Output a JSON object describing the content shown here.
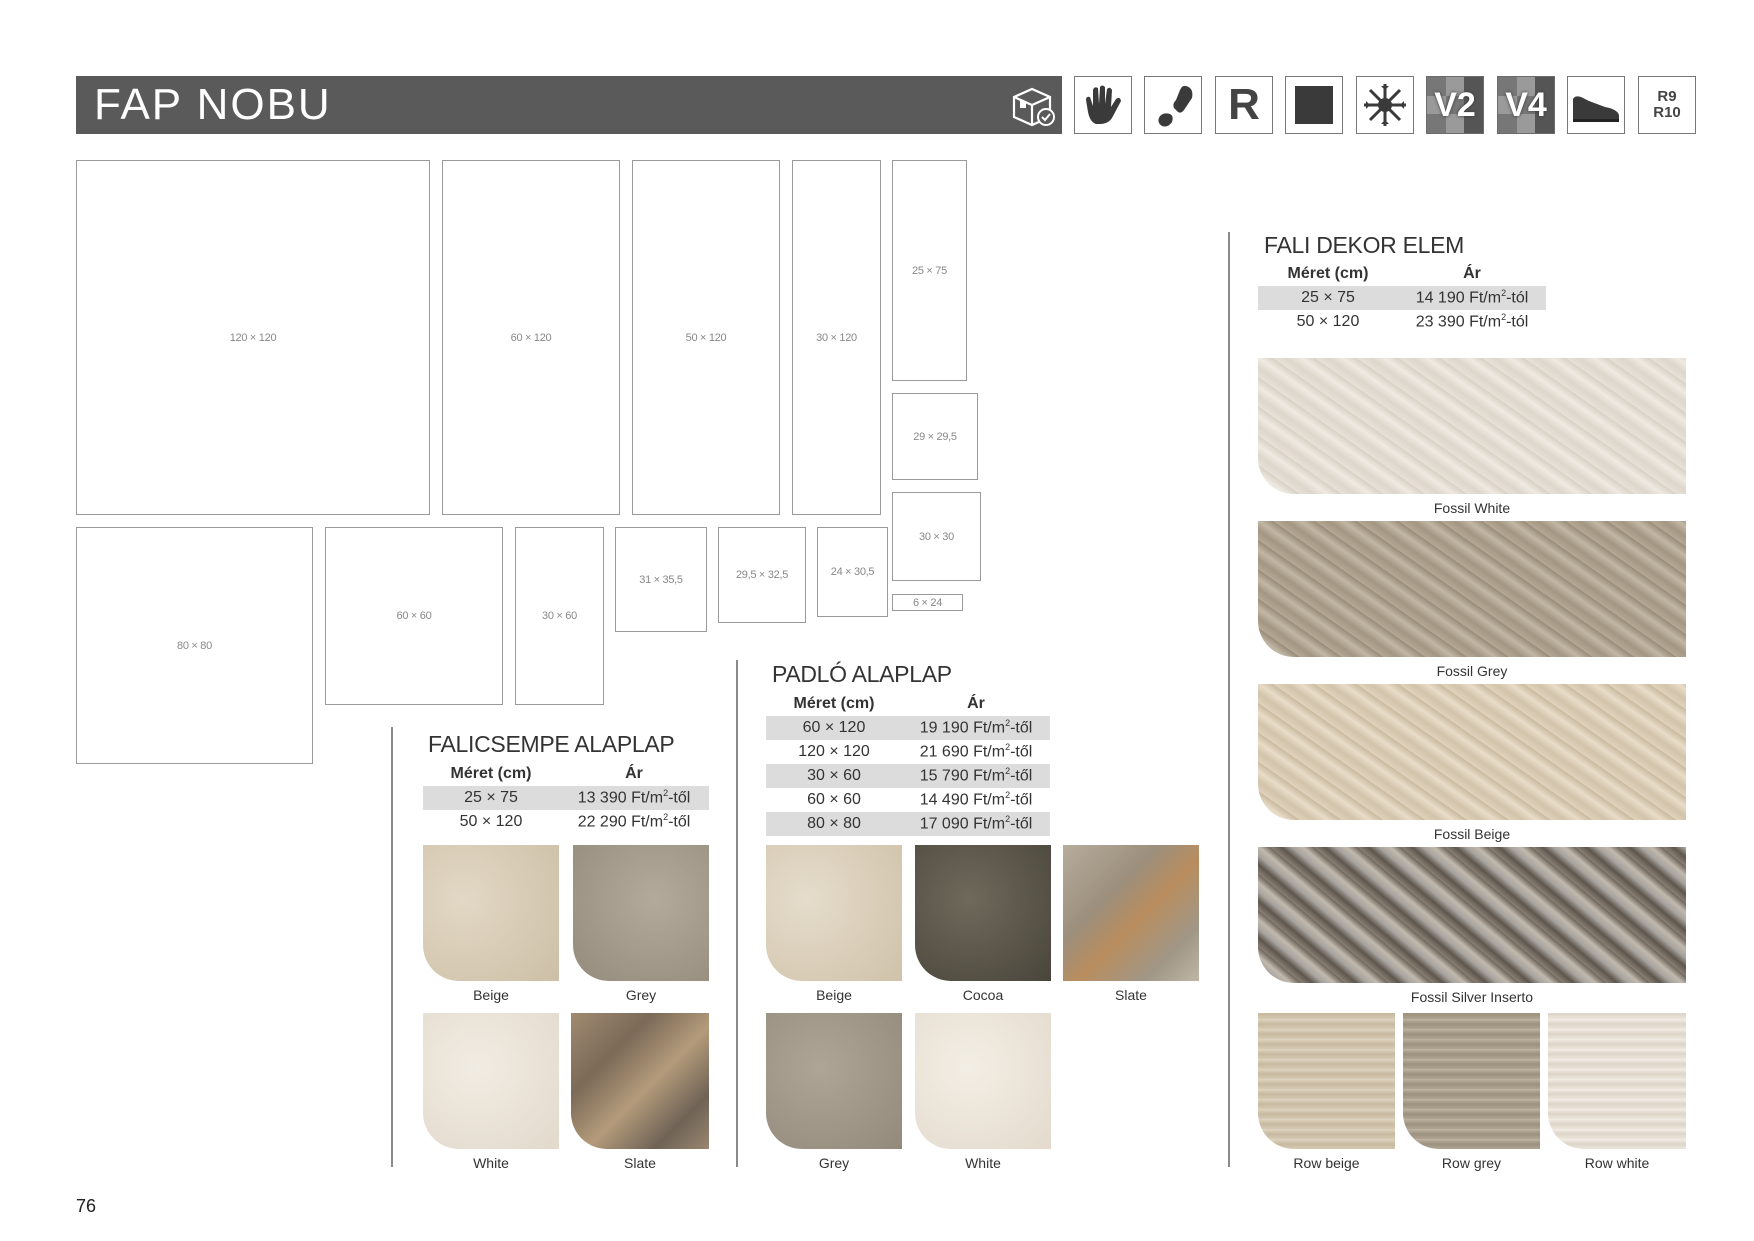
{
  "header": {
    "title": "FAP NOBU"
  },
  "icons": {
    "header_icon": "box-check-icon",
    "features": [
      "hand-icon",
      "foot-icon",
      "r-icon",
      "square-icon",
      "snowflake-icon",
      "v2-icon",
      "v4-icon",
      "shoe-icon",
      "rating-icon"
    ],
    "r_label": "R",
    "v2_label": "V2",
    "v4_label": "V4",
    "rating_line1": "R9",
    "rating_line2": "R10"
  },
  "sizes": {
    "s120x120": "120 × 120",
    "s60x120": "60 × 120",
    "s50x120": "50 × 120",
    "s30x120": "30 × 120",
    "s25x75": "25 × 75",
    "s29x295": "29 × 29,5",
    "s30x30": "30 × 30",
    "s6x24": "6 × 24",
    "s80x80": "80 × 80",
    "s60x60": "60 × 60",
    "s30x60": "30 × 60",
    "s31x355": "31 × 35,5",
    "s295x325": "29,5 × 32,5",
    "s24x305": "24 × 30,5"
  },
  "falicsempe": {
    "title": "FALICSEMPE ALAPLAP",
    "col_size": "Méret (cm)",
    "col_price": "Ár",
    "rows": [
      {
        "size": "25 × 75",
        "price_main": "13 390 Ft/m",
        "price_sup": "2",
        "price_suffix": "-től"
      },
      {
        "size": "50 × 120",
        "price_main": "22 290 Ft/m",
        "price_sup": "2",
        "price_suffix": "-től"
      }
    ],
    "tiles": [
      "Beige",
      "Grey",
      "White",
      "Slate"
    ]
  },
  "padlo": {
    "title": "PADLÓ ALAPLAP",
    "col_size": "Méret (cm)",
    "col_price": "Ár",
    "rows": [
      {
        "size": "60 × 120",
        "price_main": "19 190 Ft/m",
        "price_sup": "2",
        "price_suffix": "-től"
      },
      {
        "size": "120 × 120",
        "price_main": "21 690 Ft/m",
        "price_sup": "2",
        "price_suffix": "-től"
      },
      {
        "size": "30 × 60",
        "price_main": "15 790 Ft/m",
        "price_sup": "2",
        "price_suffix": "-től"
      },
      {
        "size": "60 × 60",
        "price_main": "14 490 Ft/m",
        "price_sup": "2",
        "price_suffix": "-től"
      },
      {
        "size": "80 × 80",
        "price_main": "17 090 Ft/m",
        "price_sup": "2",
        "price_suffix": "-től"
      }
    ],
    "tiles": [
      "Beige",
      "Cocoa",
      "Slate",
      "Grey",
      "White"
    ]
  },
  "fali_dekor": {
    "title": "FALI DEKOR ELEM",
    "col_size": "Méret (cm)",
    "col_price": "Ár",
    "rows": [
      {
        "size": "25 × 75",
        "price_main": "14 190 Ft/m",
        "price_sup": "2",
        "price_suffix": "-tól"
      },
      {
        "size": "50 × 120",
        "price_main": "23 390 Ft/m",
        "price_sup": "2",
        "price_suffix": "-tól"
      }
    ],
    "decors": [
      "Fossil White",
      "Fossil Grey",
      "Fossil Beige",
      "Fossil Silver Inserto"
    ],
    "rows_tiles": [
      "Row beige",
      "Row grey",
      "Row white"
    ]
  },
  "page_number": "76",
  "colors": {
    "header_bg": "#5a5a5a",
    "table_shade": "#dcdcdc",
    "beige": "#d9cdb8",
    "grey": "#a69d90",
    "white": "#ece6dc",
    "slate": "#8e7b66",
    "cocoa": "#5b5548"
  }
}
